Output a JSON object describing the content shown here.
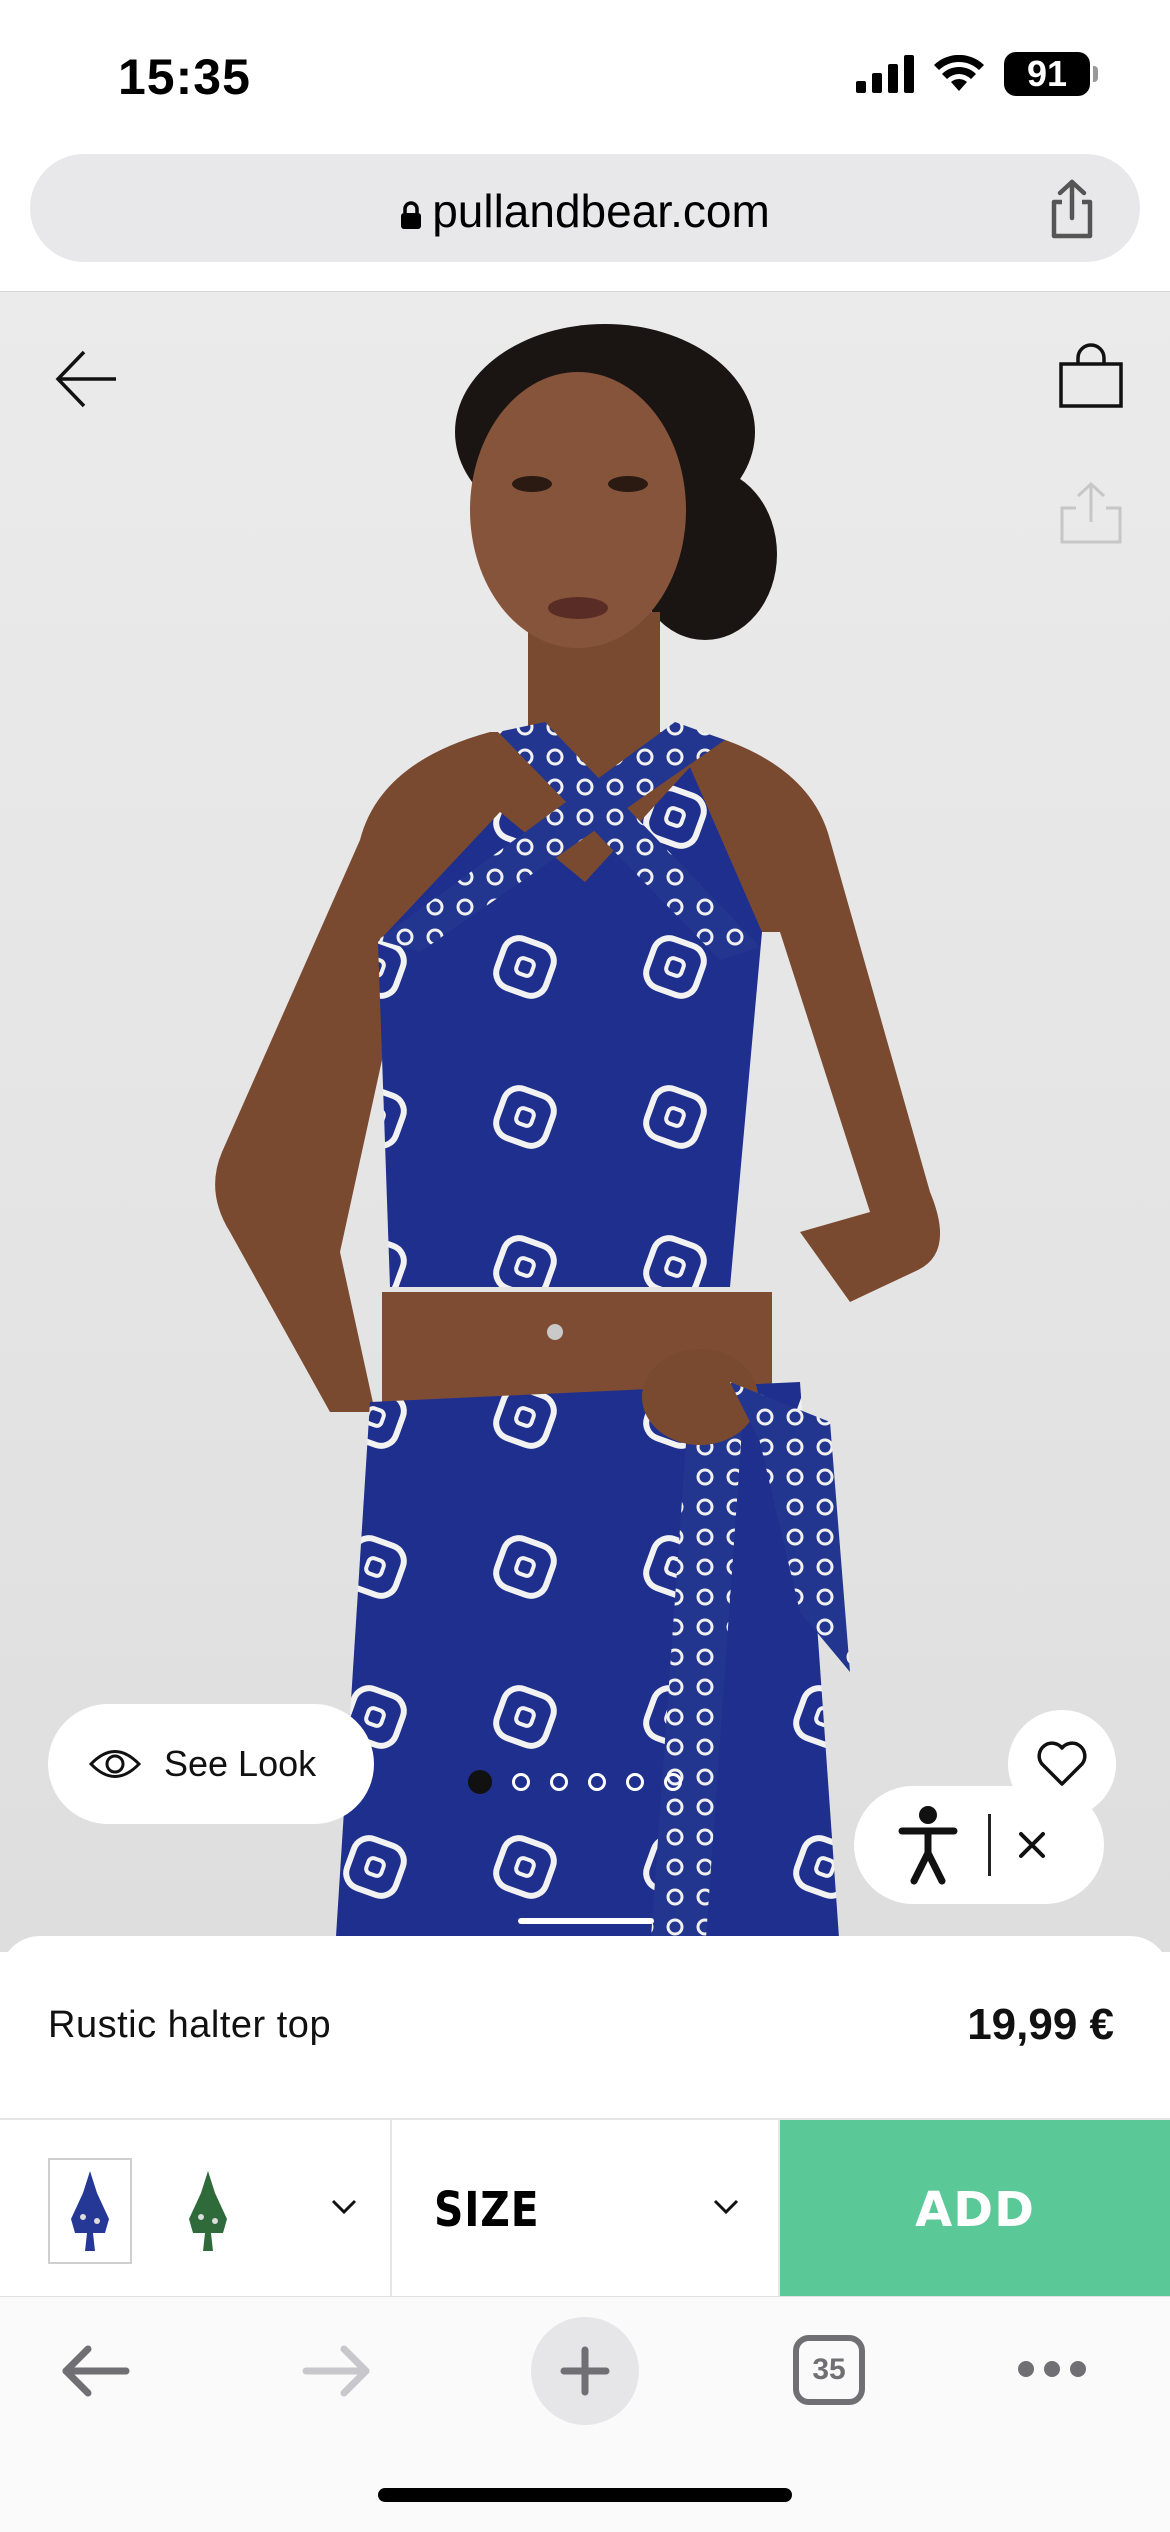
{
  "status_bar": {
    "time": "15:35",
    "battery": "91",
    "icons": [
      "signal-icon",
      "wifi-icon",
      "battery-icon"
    ]
  },
  "browser": {
    "url": "pullandbear.com",
    "open_tabs": "35"
  },
  "gallery": {
    "see_look_label": "See Look",
    "image_count": 6,
    "active_image": 1
  },
  "product": {
    "name": "Rustic halter top",
    "price": "19,99 €",
    "colors": [
      "navy-bandana-print",
      "green-print"
    ],
    "selected_color": 0
  },
  "actions": {
    "size_label": "SIZE",
    "add_label": "ADD"
  },
  "colors": {
    "accent_add": "#5bc898",
    "garment_blue": "#1e2f8c"
  }
}
